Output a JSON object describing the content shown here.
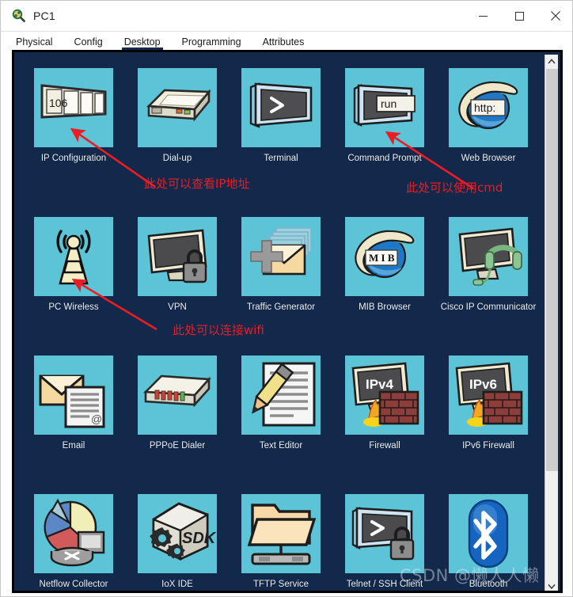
{
  "window": {
    "title": "PC1",
    "icon": "packet-tracer-device-icon",
    "controls": {
      "minimize": "—",
      "maximize": "☐",
      "close": "✕"
    }
  },
  "tabs": [
    {
      "label": "Physical",
      "active": false
    },
    {
      "label": "Config",
      "active": false
    },
    {
      "label": "Desktop",
      "active": true
    },
    {
      "label": "Programming",
      "active": false
    },
    {
      "label": "Attributes",
      "active": false
    }
  ],
  "desktop": {
    "background_color": "#13294b",
    "tile_color": "#5cc4d6",
    "items": [
      {
        "label": "IP Configuration",
        "icon": "ip-configuration-icon",
        "badge": "106"
      },
      {
        "label": "Dial-up",
        "icon": "dialup-modem-icon"
      },
      {
        "label": "Terminal",
        "icon": "terminal-icon",
        "glyph": ">"
      },
      {
        "label": "Command Prompt",
        "icon": "command-prompt-icon",
        "glyph": "run"
      },
      {
        "label": "Web Browser",
        "icon": "web-browser-icon",
        "glyph": "http:"
      },
      {
        "label": "PC Wireless",
        "icon": "pc-wireless-antenna-icon"
      },
      {
        "label": "VPN",
        "icon": "vpn-monitor-lock-icon"
      },
      {
        "label": "Traffic Generator",
        "icon": "traffic-generator-envelope-icon"
      },
      {
        "label": "MIB Browser",
        "icon": "mib-browser-icon",
        "glyph": "M I B"
      },
      {
        "label": "Cisco IP Communicator",
        "icon": "cisco-ip-communicator-icon"
      },
      {
        "label": "Email",
        "icon": "email-icon"
      },
      {
        "label": "PPPoE Dialer",
        "icon": "pppoe-dialer-icon"
      },
      {
        "label": "Text Editor",
        "icon": "text-editor-icon"
      },
      {
        "label": "Firewall",
        "icon": "firewall-icon",
        "glyph": "IPv4"
      },
      {
        "label": "IPv6 Firewall",
        "icon": "ipv6-firewall-icon",
        "glyph": "IPv6"
      },
      {
        "label": "Netflow Collector",
        "icon": "netflow-collector-icon"
      },
      {
        "label": "IoX IDE",
        "icon": "iox-ide-icon",
        "glyph": "SDK"
      },
      {
        "label": "TFTP Service",
        "icon": "tftp-service-icon"
      },
      {
        "label": "Telnet / SSH Client",
        "icon": "telnet-ssh-client-icon",
        "glyph": ">"
      },
      {
        "label": "Bluetooth",
        "icon": "bluetooth-icon"
      }
    ]
  },
  "annotations": [
    {
      "text": "此处可以查看IP地址",
      "color": "#ec1c24",
      "points_to": "IP Configuration"
    },
    {
      "text": "此处可以使用cmd",
      "color": "#ec1c24",
      "points_to": "Command Prompt"
    },
    {
      "text": "此处可以连接wifi",
      "color": "#ec1c24",
      "points_to": "PC Wireless"
    }
  ],
  "watermark": {
    "text": "CSDN @懒人人懒"
  },
  "scrollbar": {
    "up_arrow": "⌃",
    "down_arrow": "⌄",
    "position_percent": 0
  }
}
